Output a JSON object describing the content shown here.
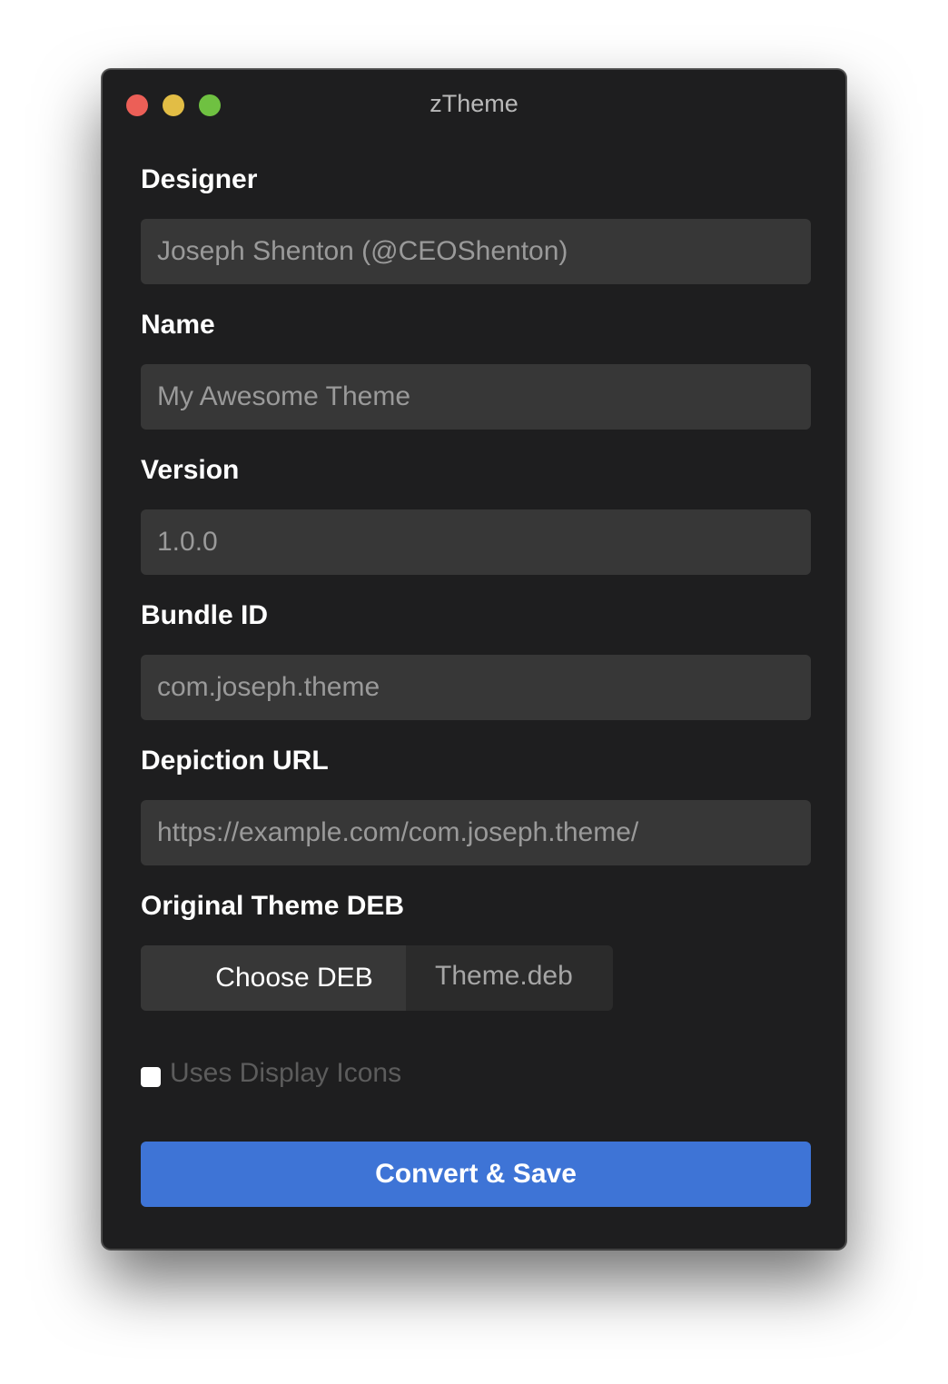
{
  "window": {
    "title": "zTheme"
  },
  "form": {
    "designer": {
      "label": "Designer",
      "placeholder": "Joseph Shenton (@CEOShenton)"
    },
    "name": {
      "label": "Name",
      "placeholder": "My Awesome Theme"
    },
    "version": {
      "label": "Version",
      "placeholder": "1.0.0"
    },
    "bundle_id": {
      "label": "Bundle ID",
      "placeholder": "com.joseph.theme"
    },
    "depiction_url": {
      "label": "Depiction URL",
      "placeholder": "https://example.com/com.joseph.theme/"
    },
    "original_deb": {
      "label": "Original Theme DEB",
      "button_label": "Choose DEB",
      "file_name": "Theme.deb"
    },
    "display_icons": {
      "label": "Uses Display Icons",
      "checked": false
    },
    "submit_label": "Convert & Save"
  },
  "colors": {
    "window_bg": "#1e1e1f",
    "field_bg": "#373737",
    "accent": "#3e74d6",
    "close": "#ec5f57",
    "minimize": "#e2bd45",
    "maximize": "#6fc141"
  }
}
